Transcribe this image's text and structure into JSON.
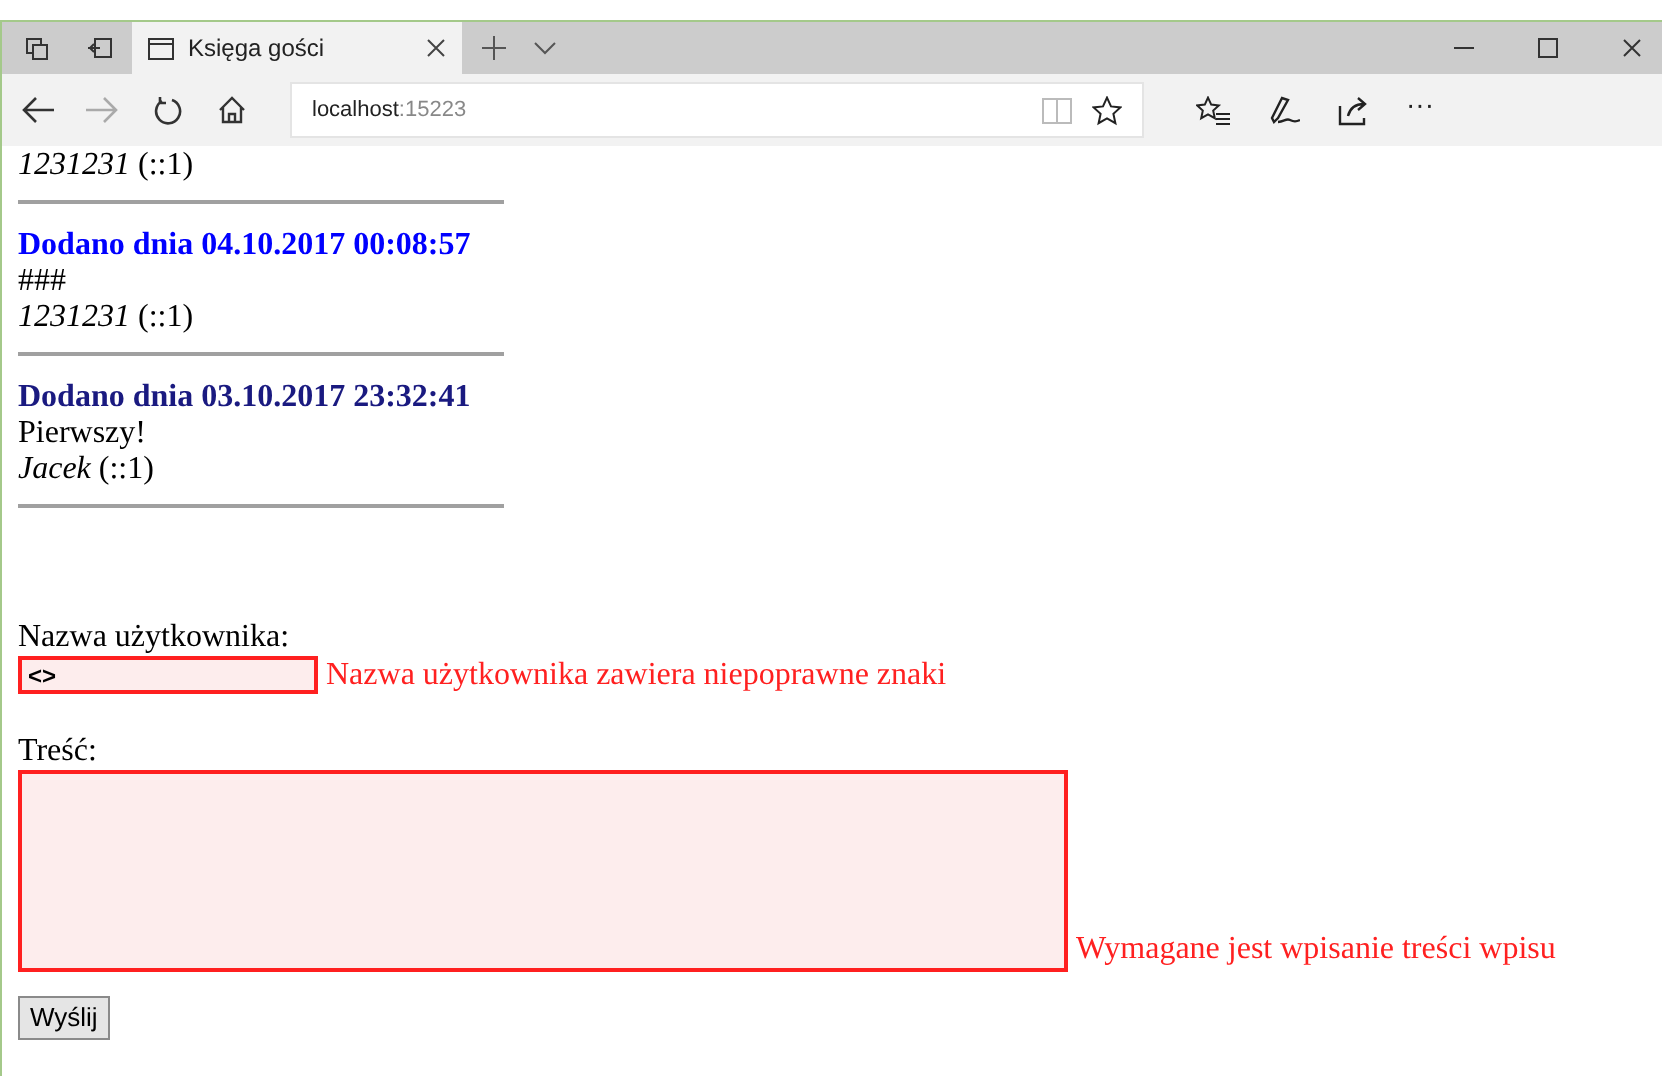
{
  "browser": {
    "tab_title": "Księga gości",
    "address_host": "localhost",
    "address_port": ":15223",
    "more": "···"
  },
  "entries": [
    {
      "author": "1231231",
      "ip": "(::1)"
    },
    {
      "header": "Dodano dnia 04.10.2017 00:08:57",
      "color": "#0000ff",
      "message": "###",
      "author": "1231231",
      "ip": "(::1)"
    },
    {
      "header": "Dodano dnia 03.10.2017 23:32:41",
      "color": "#1a1a80",
      "message": "Pierwszy!",
      "author": "Jacek",
      "ip": "(::1)"
    }
  ],
  "form": {
    "username_label": "Nazwa użytkownika:",
    "username_value": "<>",
    "username_invalid": true,
    "username_error": "Nazwa użytkownika zawiera niepoprawne znaki",
    "content_label": "Treść:",
    "content_invalid": true,
    "content_error": "Wymagane jest wpisanie treści wpisu",
    "submit": "Wyślij"
  }
}
